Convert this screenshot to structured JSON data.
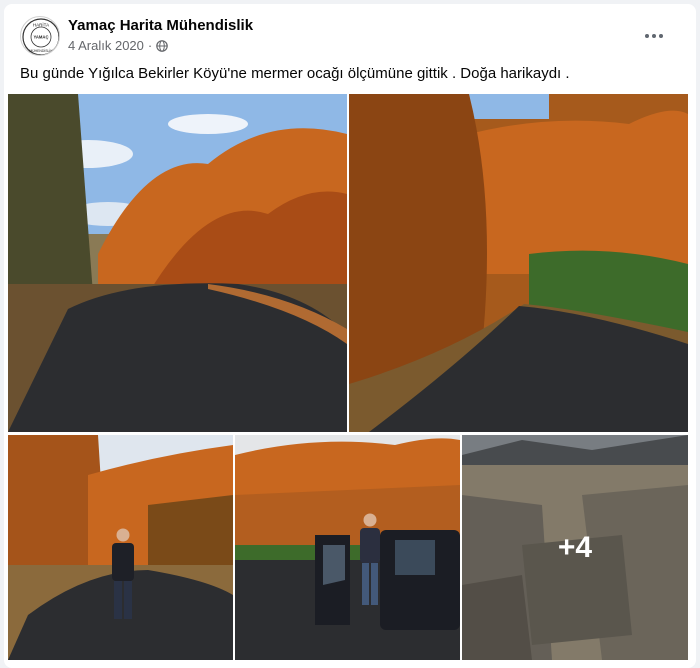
{
  "post": {
    "author": "Yamaç Harita Mühendislik",
    "date": "4 Aralık 2020",
    "separator": "·",
    "privacy_icon": "globe-icon",
    "more_icon": "more-options-icon",
    "avatar_text": {
      "top": "HARİTA",
      "middle": "YAMAÇ",
      "bottom": "MÜHENDİSLİK"
    },
    "caption": "Bu günde Yığılca Bekirler Köyü'ne mermer ocağı ölçümüne gittik . Doğa harikaydı ."
  },
  "gallery": {
    "photos": [
      {
        "name": "road-autumn-forest-photo"
      },
      {
        "name": "road-orange-trees-photo"
      },
      {
        "name": "man-on-road-photo"
      },
      {
        "name": "man-by-truck-photo"
      },
      {
        "name": "marble-quarry-photo"
      }
    ],
    "more_count": "+4"
  },
  "colors": {
    "autumn_orange": "#c8671f",
    "asphalt": "#2c2d30",
    "sky": "#8fb8e6"
  }
}
